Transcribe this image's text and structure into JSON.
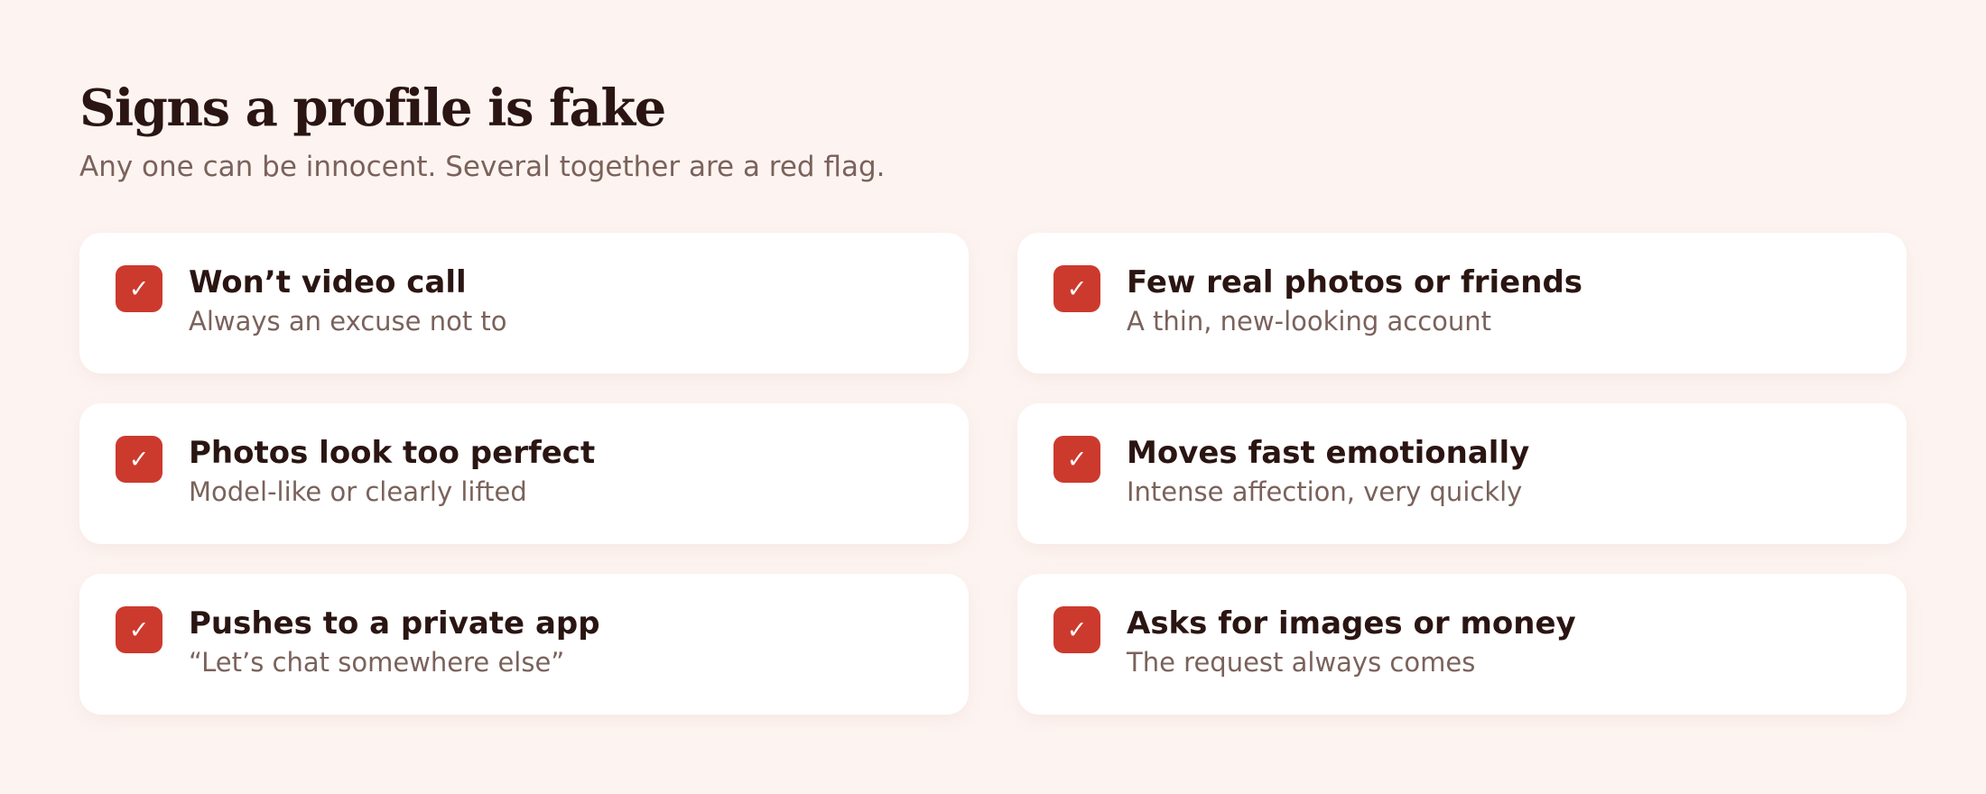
{
  "header": {
    "title": "Signs a profile is fake",
    "subtitle": "Any one can be innocent. Several together are a red flag."
  },
  "colors": {
    "accent": "#cc3a2e",
    "background": "#fdf4f1",
    "heading": "#2a1512",
    "muted": "#7a625b",
    "card": "#ffffff"
  },
  "check_icon": "checkmark-icon",
  "check_glyph": "✓",
  "signs": [
    {
      "label": "Won’t video call",
      "description": "Always an excuse not to",
      "checked": true
    },
    {
      "label": "Few real photos or friends",
      "description": "A thin, new-looking account",
      "checked": true
    },
    {
      "label": "Photos look too perfect",
      "description": "Model-like or clearly lifted",
      "checked": true
    },
    {
      "label": "Moves fast emotionally",
      "description": "Intense affection, very quickly",
      "checked": true
    },
    {
      "label": "Pushes to a private app",
      "description": "“Let’s chat somewhere else”",
      "checked": true
    },
    {
      "label": "Asks for images or money",
      "description": "The request always comes",
      "checked": true
    }
  ]
}
